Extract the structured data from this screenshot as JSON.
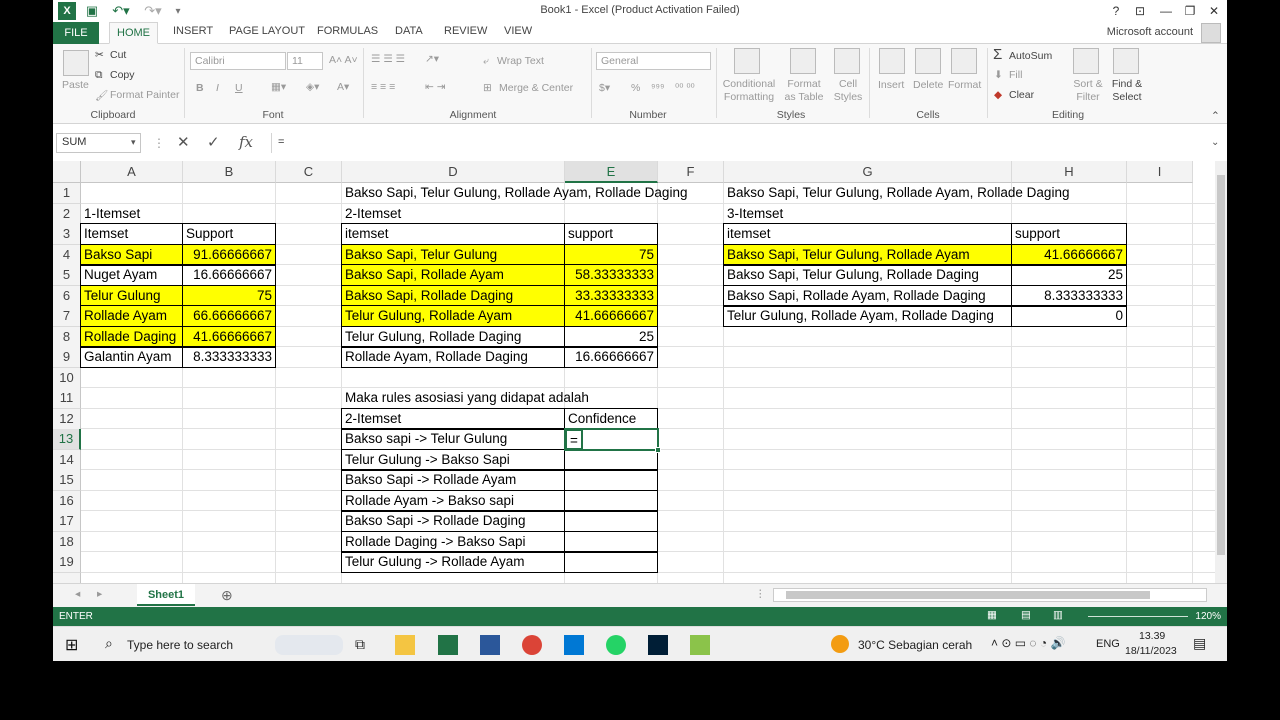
{
  "window": {
    "title": "Book1 - Excel (Product Activation Failed)",
    "account": "Microsoft account",
    "help": "?",
    "min": "—",
    "restore": "❐",
    "close": "✕"
  },
  "ribbon": {
    "tabs": [
      "FILE",
      "HOME",
      "INSERT",
      "PAGE LAYOUT",
      "FORMULAS",
      "DATA",
      "REVIEW",
      "VIEW"
    ],
    "clipboard": {
      "paste": "Paste",
      "cut": "Cut",
      "copy": "Copy",
      "format_painter": "Format Painter",
      "label": "Clipboard"
    },
    "font": {
      "name": "Calibri",
      "size": "11",
      "label": "Font",
      "bold": "B",
      "italic": "I",
      "underline": "U"
    },
    "alignment": {
      "wrap": "Wrap Text",
      "merge": "Merge & Center",
      "label": "Alignment"
    },
    "number": {
      "format": "General",
      "label": "Number",
      "percent": "%"
    },
    "styles": {
      "conditional": "Conditional Formatting",
      "format_table": "Format as Table",
      "cell_styles": "Cell Styles",
      "label": "Styles"
    },
    "cells": {
      "insert": "Insert",
      "delete": "Delete",
      "format": "Format",
      "label": "Cells"
    },
    "editing": {
      "autosum": "AutoSum",
      "fill": "Fill",
      "clear": "Clear",
      "sort": "Sort & Filter",
      "find": "Find & Select",
      "label": "Editing"
    }
  },
  "formula_bar": {
    "name_box": "SUM",
    "content": "="
  },
  "columns": [
    "A",
    "B",
    "C",
    "D",
    "E",
    "F",
    "G",
    "H",
    "I"
  ],
  "rows": [
    "1",
    "2",
    "3",
    "4",
    "5",
    "6",
    "7",
    "8",
    "9",
    "10",
    "11",
    "12",
    "13",
    "14",
    "15",
    "16",
    "17",
    "18",
    "19"
  ],
  "sheet": {
    "d1": "Bakso Sapi, Telur Gulung, Rollade Ayam, Rollade Daging",
    "g1": "Bakso Sapi, Telur Gulung, Rollade Ayam, Rollade Daging",
    "a2": "1-Itemset",
    "d2": "2-Itemset",
    "g2": "3-Itemset",
    "table1": {
      "headers": [
        "Itemset",
        "Support"
      ],
      "rows": [
        {
          "item": "Bakso Sapi",
          "support": "91.66666667",
          "hl": true
        },
        {
          "item": "Nuget Ayam",
          "support": "16.66666667",
          "hl": false
        },
        {
          "item": "Telur Gulung",
          "support": "75",
          "hl": true
        },
        {
          "item": "Rollade Ayam",
          "support": "66.66666667",
          "hl": true
        },
        {
          "item": "Rollade Daging",
          "support": "41.66666667",
          "hl": true
        },
        {
          "item": "Galantin Ayam",
          "support": "8.333333333",
          "hl": false
        }
      ]
    },
    "table2": {
      "headers": [
        "itemset",
        "support"
      ],
      "rows": [
        {
          "item": "Bakso Sapi, Telur Gulung",
          "support": "75",
          "hl": true
        },
        {
          "item": "Bakso Sapi, Rollade Ayam",
          "support": "58.33333333",
          "hl": true
        },
        {
          "item": "Bakso Sapi, Rollade Daging",
          "support": "33.33333333",
          "hl": true
        },
        {
          "item": "Telur Gulung, Rollade Ayam",
          "support": "41.66666667",
          "hl": true
        },
        {
          "item": "Telur Gulung, Rollade Daging",
          "support": "25",
          "hl": false
        },
        {
          "item": "Rollade Ayam, Rollade Daging",
          "support": "16.66666667",
          "hl": false
        }
      ]
    },
    "table3": {
      "headers": [
        "itemset",
        "support"
      ],
      "rows": [
        {
          "item": "Bakso Sapi, Telur Gulung, Rollade Ayam",
          "support": "41.66666667",
          "hl": true
        },
        {
          "item": "Bakso Sapi, Telur Gulung, Rollade Daging",
          "support": "25",
          "hl": false
        },
        {
          "item": "Bakso Sapi, Rollade Ayam, Rollade Daging",
          "support": "8.333333333",
          "hl": false
        },
        {
          "item": "Telur Gulung, Rollade Ayam, Rollade Daging",
          "support": "0",
          "hl": false
        }
      ]
    },
    "d11": "Maka rules asosiasi yang didapat adalah",
    "rules": {
      "headers": [
        "2-Itemset",
        "Confidence"
      ],
      "rows": [
        {
          "rule": "Bakso sapi -> Telur Gulung",
          "conf": "="
        },
        {
          "rule": "Telur Gulung -> Bakso Sapi",
          "conf": ""
        },
        {
          "rule": "Bakso Sapi -> Rollade Ayam",
          "conf": ""
        },
        {
          "rule": "Rollade Ayam -> Bakso sapi",
          "conf": ""
        },
        {
          "rule": "Bakso Sapi -> Rollade Daging",
          "conf": ""
        },
        {
          "rule": "Rollade Daging -> Bakso Sapi",
          "conf": ""
        },
        {
          "rule": "Telur Gulung -> Rollade Ayam",
          "conf": ""
        }
      ]
    }
  },
  "sheet_tab": "Sheet1",
  "status": {
    "mode": "ENTER",
    "zoom": "120%"
  },
  "taskbar": {
    "search": "Type here to search",
    "weather": "30°C  Sebagian cerah",
    "lang": "ENG",
    "time": "13.39",
    "date": "18/11/2023"
  },
  "colors": {
    "excel_green": "#217346",
    "highlight": "#ffff00"
  }
}
